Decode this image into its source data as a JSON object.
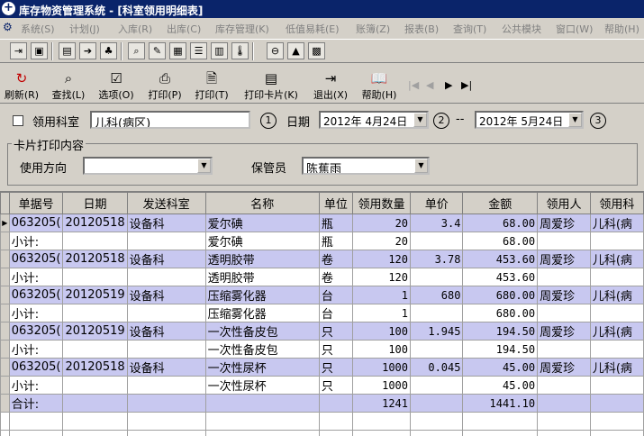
{
  "window": {
    "title": "库存物资管理系统 - [科室领用明细表]"
  },
  "menu": [
    {
      "label": "系统(S)"
    },
    {
      "label": "计划(J)"
    },
    {
      "label": "入库(R)"
    },
    {
      "label": "出库(C)"
    },
    {
      "label": "库存管理(K)"
    },
    {
      "label": "低值易耗(E)"
    },
    {
      "label": "账簿(Z)"
    },
    {
      "label": "报表(B)"
    },
    {
      "label": "查询(T)"
    },
    {
      "label": "公共模块"
    },
    {
      "label": "窗口(W)"
    },
    {
      "label": "帮助(H)"
    }
  ],
  "toolbar2": {
    "refresh": "刷新(R)",
    "find": "查找(L)",
    "options": "选项(O)",
    "print_p": "打印(P)",
    "print_t": "打印(T)",
    "print_card": "打印卡片(K)",
    "exit": "退出(X)",
    "help": "帮助(H)"
  },
  "filter": {
    "dept_label": "领用科室",
    "dept_value": "儿科(病区)",
    "mark1": "1",
    "date_label": "日期",
    "date_from": "2012年 4月24日",
    "mark2": "2",
    "dash": "--",
    "date_to": "2012年 5月24日",
    "mark3": "3"
  },
  "card": {
    "group_label": "卡片打印内容",
    "direction_label": "使用方向",
    "direction_value": "",
    "keeper_label": "保管员",
    "keeper_value": "陈蕉雨"
  },
  "table": {
    "columns": [
      "单据号",
      "日期",
      "发送科室",
      "名称",
      "单位",
      "领用数量",
      "单价",
      "金额",
      "领用人",
      "领用科"
    ],
    "rows": [
      {
        "kind": "detail",
        "cells": [
          "063205(",
          "20120518",
          "设备科",
          "爱尔碘",
          "瓶",
          "20",
          "3.4",
          "68.00",
          "周爱珍",
          "儿科(病"
        ]
      },
      {
        "kind": "subtotal",
        "cells": [
          "小计:",
          "",
          "",
          "爱尔碘",
          "瓶",
          "20",
          "",
          "68.00",
          "",
          ""
        ]
      },
      {
        "kind": "detail",
        "cells": [
          "063205(",
          "20120518",
          "设备科",
          "透明胶带",
          "卷",
          "120",
          "3.78",
          "453.60",
          "周爱珍",
          "儿科(病"
        ]
      },
      {
        "kind": "subtotal",
        "cells": [
          "小计:",
          "",
          "",
          "透明胶带",
          "卷",
          "120",
          "",
          "453.60",
          "",
          ""
        ]
      },
      {
        "kind": "detail",
        "cells": [
          "063205(",
          "20120519",
          "设备科",
          "压缩雾化器",
          "台",
          "1",
          "680",
          "680.00",
          "周爱珍",
          "儿科(病"
        ]
      },
      {
        "kind": "subtotal",
        "cells": [
          "小计:",
          "",
          "",
          "压缩雾化器",
          "台",
          "1",
          "",
          "680.00",
          "",
          ""
        ]
      },
      {
        "kind": "detail",
        "cells": [
          "063205(",
          "20120519",
          "设备科",
          "一次性备皮包",
          "只",
          "100",
          "1.945",
          "194.50",
          "周爱珍",
          "儿科(病"
        ]
      },
      {
        "kind": "subtotal",
        "cells": [
          "小计:",
          "",
          "",
          "一次性备皮包",
          "只",
          "100",
          "",
          "194.50",
          "",
          ""
        ]
      },
      {
        "kind": "detail",
        "cells": [
          "063205(",
          "20120518",
          "设备科",
          "一次性尿杯",
          "只",
          "1000",
          "0.045",
          "45.00",
          "周爱珍",
          "儿科(病"
        ]
      },
      {
        "kind": "subtotal",
        "cells": [
          "小计:",
          "",
          "",
          "一次性尿杯",
          "只",
          "1000",
          "",
          "45.00",
          "",
          ""
        ]
      },
      {
        "kind": "total",
        "cells": [
          "合计:",
          "",
          "",
          "",
          "",
          "1241",
          "",
          "1441.10",
          "",
          ""
        ]
      }
    ]
  }
}
